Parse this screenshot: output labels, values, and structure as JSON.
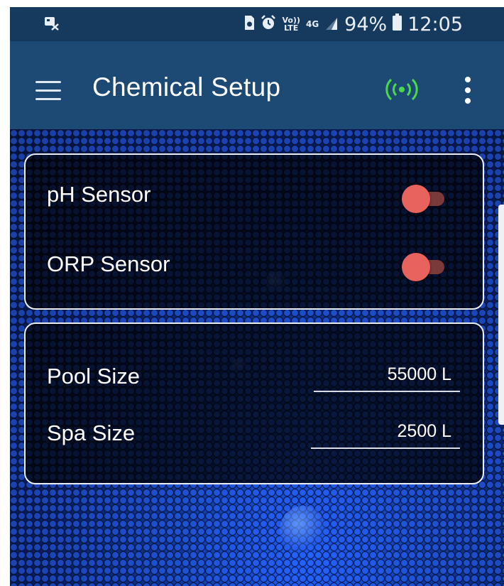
{
  "status_bar": {
    "left_icon": "message-notification-icon",
    "icons": [
      "sim-card-icon",
      "alarm-icon",
      "volte-icon",
      "4g-icon",
      "signal-icon"
    ],
    "volte_text": [
      "Vo))",
      "LTE"
    ],
    "network_text": "4G",
    "battery_percent": "94%",
    "time": "12:05"
  },
  "app_bar": {
    "title": "Chemical Setup",
    "connection_status": "connected",
    "colors": {
      "background": "#1d4a74",
      "connection_icon": "#4cd84c"
    }
  },
  "sensors": {
    "ph": {
      "label": "pH Sensor",
      "enabled": false
    },
    "orp": {
      "label": "ORP Sensor",
      "enabled": false
    }
  },
  "sizes": {
    "pool": {
      "label": "Pool Size",
      "value": "55000 L"
    },
    "spa": {
      "label": "Spa Size",
      "value": "2500 L"
    }
  },
  "colors": {
    "toggle_knob": "#e8625e",
    "toggle_track": "#7a3a3a",
    "card_border": "#e9eef6"
  }
}
